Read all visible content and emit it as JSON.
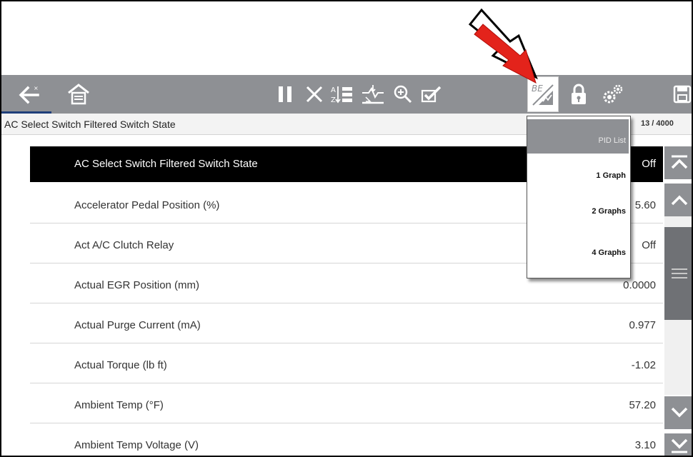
{
  "toolbar": {
    "icons": [
      "back-icon",
      "home-icon",
      "pause-icon",
      "clear-icon",
      "sort-icon",
      "zero-baseline-icon",
      "zoom-icon",
      "select-icon",
      "view-graph-icon",
      "lock-icon",
      "settings-icon",
      "save-icon"
    ],
    "active_icon": "view-graph-icon"
  },
  "header": {
    "title": "AC Select Switch Filtered Switch State",
    "count": "13 / 4000"
  },
  "view_menu": {
    "items": [
      {
        "label": "PID List",
        "active": true
      },
      {
        "label": "1 Graph",
        "active": false
      },
      {
        "label": "2 Graphs",
        "active": false
      },
      {
        "label": "4 Graphs",
        "active": false
      }
    ]
  },
  "pid_list": [
    {
      "name": "AC Select Switch Filtered Switch State",
      "value": "Off",
      "selected": true
    },
    {
      "name": "Accelerator Pedal Position (%)",
      "value": "5.60",
      "selected": false
    },
    {
      "name": "Act A/C Clutch Relay",
      "value": "Off",
      "selected": false
    },
    {
      "name": "Actual EGR Position (mm)",
      "value": "0.0000",
      "selected": false
    },
    {
      "name": "Actual Purge Current (mA)",
      "value": "0.977",
      "selected": false
    },
    {
      "name": "Actual Torque (lb ft)",
      "value": "-1.02",
      "selected": false
    },
    {
      "name": "Ambient Temp (°F)",
      "value": "57.20",
      "selected": false
    },
    {
      "name": "Ambient Temp Voltage (V)",
      "value": "3.10",
      "selected": false
    }
  ],
  "colors": {
    "toolbar": "#8e9094",
    "selected_row": "#000000",
    "annotation_arrow": "#e3231b",
    "progress": "#1f3f7a"
  }
}
